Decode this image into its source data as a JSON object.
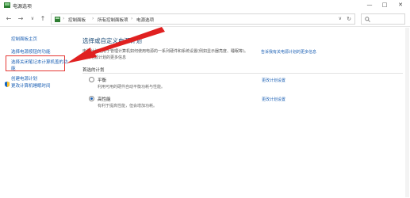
{
  "window": {
    "title": "电源选项",
    "minimize": "—",
    "maximize": "□",
    "close": "✕"
  },
  "nav": {
    "back": "←",
    "forward": "→",
    "dropdown": "∨",
    "up": "↑",
    "breadcrumb": [
      "控制面板",
      "所有控制面板项",
      "电源选项"
    ],
    "separator": "›",
    "addr_dropdown": "∨",
    "refresh": "↻",
    "search_placeholder": ""
  },
  "sidebar": {
    "home": "控制面板主页",
    "items": [
      {
        "label": "选择电源按钮的功能"
      },
      {
        "label_line1": "选择关闭笔记本计算机盖的功",
        "label_line2": "能"
      },
      {
        "label": "创建电源计划"
      },
      {
        "label": "更改计算机睡眠时间"
      }
    ]
  },
  "main": {
    "title": "选择或自定义电源计划",
    "description_line1": "电源计划是用于管理计算机如何使用电源的一系列硬件和系统设置(例如显示器亮度、睡眠等)。",
    "description_line2": "有关电源计划的更多信息",
    "description_link": "告诉我有关电源计划的更多信息",
    "section_label": "首选的计划",
    "plans": [
      {
        "name": "平衡",
        "desc": "利用可用的硬件自动平衡功耗与性能。",
        "link": "更改计划设置",
        "selected": false
      },
      {
        "name": "高性能",
        "desc": "有利于提高性能，但会增加功耗。",
        "link": "更改计划设置",
        "selected": true
      }
    ]
  },
  "colors": {
    "accent": "#1a5fb4",
    "annotation": "#e53935"
  },
  "icons": [
    "app-icon",
    "back-icon",
    "forward-icon",
    "up-icon",
    "control-panel-icon",
    "refresh-icon",
    "search-icon",
    "shield-icon",
    "annotation-arrow"
  ]
}
